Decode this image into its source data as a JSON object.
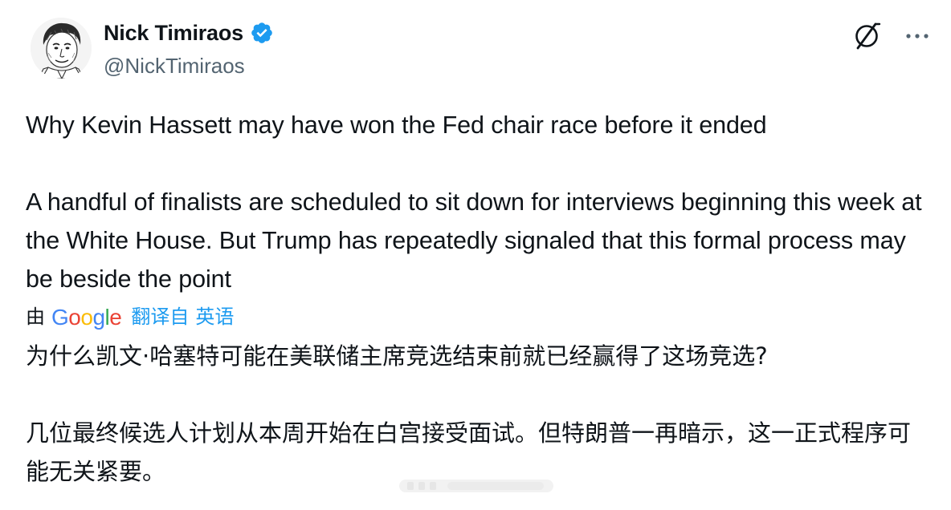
{
  "author": {
    "display_name": "Nick Timiraos",
    "handle": "@NickTimiraos",
    "verified": true,
    "verified_color": "#1d9bf0"
  },
  "actions": {
    "grok_icon": "grok-icon",
    "more_icon": "more-icon"
  },
  "tweet": {
    "text": "Why Kevin Hassett may have won the Fed chair race before it ended\n\nA handful of finalists are scheduled to sit down for interviews beginning this week at the White House. But Trump has repeatedly signaled that this formal process may be beside the point"
  },
  "translation": {
    "by_label": "由",
    "provider": "Google",
    "from_label": "翻译自",
    "language": "英语",
    "link_color": "#1d9bf0",
    "text": "为什么凯文·哈塞特可能在美联储主席竞选结束前就已经赢得了这场竞选?\n\n几位最终候选人计划从本周开始在白宫接受面试。但特朗普一再暗示，这一正式程序可能无关紧要。"
  },
  "colors": {
    "text_primary": "#0f1419",
    "text_secondary": "#536471"
  }
}
